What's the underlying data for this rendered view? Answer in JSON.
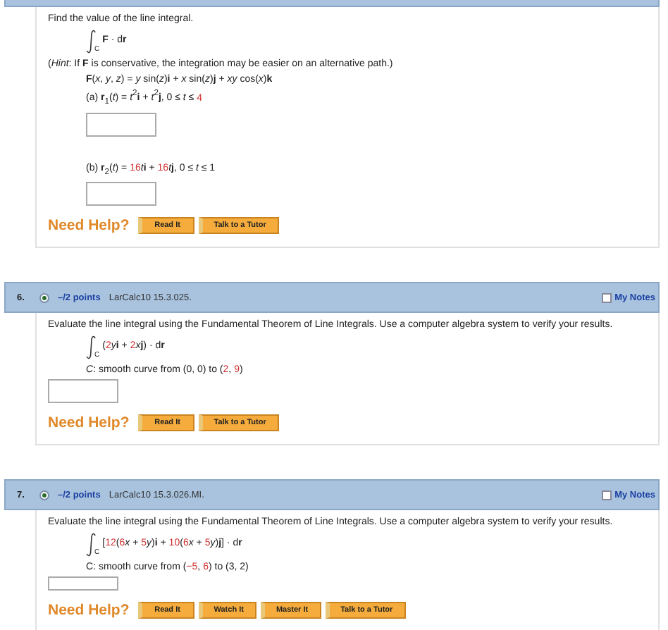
{
  "questions": [
    {
      "kind": "partial",
      "body": [
        {
          "kind": "text",
          "text": "Find the value of the line integral."
        },
        {
          "kind": "integral",
          "sub": "C",
          "expr": [
            {
              "t": "**F** · d**r**",
              "red": false
            }
          ]
        },
        {
          "kind": "text",
          "text": "(*Hint*: If **F** is conservative, the integration may be easier on an alternative path.)"
        },
        {
          "kind": "math",
          "segs": [
            {
              "t": "**F**(*x*, *y*, *z*) = *y* sin(*z*)**i** + *x* sin(*z*)**j** + *xy* cos(*x*)**k**",
              "red": false
            }
          ]
        },
        {
          "kind": "math",
          "segs": [
            {
              "t": "(a)    **r**$_{1}$(*t*) = *t*$^{2}$**i** + *t*$^{2}$**j**,    0 ≤ *t* ≤ ",
              "red": false
            },
            {
              "t": "4",
              "red": true
            }
          ]
        },
        {
          "kind": "answer_indent"
        },
        {
          "kind": "gap"
        },
        {
          "kind": "math",
          "segs": [
            {
              "t": "(b)    **r**$_{2}$(*t*) = ",
              "red": false
            },
            {
              "t": "16",
              "red": true
            },
            {
              "t": "*t*",
              "red": false
            },
            {
              "t": "**i** + ",
              "red": false
            },
            {
              "t": "16",
              "red": true
            },
            {
              "t": "*t*",
              "red": false
            },
            {
              "t": "**j**,    0 ≤ *t* ≤ 1",
              "red": false
            }
          ]
        },
        {
          "kind": "answer_indent"
        },
        {
          "kind": "help",
          "label": "Need Help?",
          "buttons": [
            "Read It",
            "Talk to a Tutor"
          ]
        }
      ]
    },
    {
      "kind": "full",
      "number": "6.",
      "points": "–/2 points",
      "code": "LarCalc10 15.3.025.",
      "notes": "My Notes",
      "notes_checked": false,
      "body": [
        {
          "kind": "text",
          "text": "Evaluate the line integral using the Fundamental Theorem of Line Integrals. Use a computer algebra system to verify your results."
        },
        {
          "kind": "integral",
          "sub": "C",
          "expr": [
            {
              "t": "(",
              "red": false
            },
            {
              "t": "2",
              "red": true
            },
            {
              "t": "*y*",
              "red": false
            },
            {
              "t": "**i** + ",
              "red": false
            },
            {
              "t": "2",
              "red": true
            },
            {
              "t": "*x*",
              "red": false
            },
            {
              "t": "**j**) · d**r**",
              "red": false
            }
          ]
        },
        {
          "kind": "math",
          "segs": [
            {
              "t": "*C*: smooth curve from (0, 0) to (",
              "red": false
            },
            {
              "t": "2",
              "red": true
            },
            {
              "t": ", ",
              "red": false
            },
            {
              "t": "9",
              "red": true
            },
            {
              "t": ")",
              "red": false
            }
          ]
        },
        {
          "kind": "answer"
        },
        {
          "kind": "help",
          "label": "Need Help?",
          "buttons": [
            "Read It",
            "Talk to a Tutor"
          ]
        }
      ]
    },
    {
      "kind": "full",
      "number": "7.",
      "points": "–/2 points",
      "code": "LarCalc10 15.3.026.MI.",
      "notes": "My Notes",
      "notes_checked": false,
      "body": [
        {
          "kind": "text",
          "text": "Evaluate the line integral using the Fundamental Theorem of Line Integrals. Use a computer algebra system to verify your results."
        },
        {
          "kind": "integral",
          "sub": "C",
          "expr": [
            {
              "t": "[",
              "red": false
            },
            {
              "t": "12",
              "red": true
            },
            {
              "t": "(",
              "red": false
            },
            {
              "t": "6",
              "red": true
            },
            {
              "t": "*x* + ",
              "red": false
            },
            {
              "t": "5",
              "red": true
            },
            {
              "t": "*y*)**i** + ",
              "red": false
            },
            {
              "t": "10",
              "red": true
            },
            {
              "t": "(",
              "red": false
            },
            {
              "t": "6",
              "red": true
            },
            {
              "t": "*x* + ",
              "red": false
            },
            {
              "t": "5",
              "red": true
            },
            {
              "t": "*y*)**j**] · d**r**",
              "red": false
            }
          ]
        },
        {
          "kind": "math",
          "segs": [
            {
              "t": "C: smooth curve from (",
              "red": false
            },
            {
              "t": "−5",
              "red": true
            },
            {
              "t": ", ",
              "red": false
            },
            {
              "t": "6",
              "red": true
            },
            {
              "t": ") to (3, 2)",
              "red": false
            }
          ]
        },
        {
          "kind": "answer_short"
        },
        {
          "kind": "help",
          "label": "Need Help?",
          "buttons": [
            "Read It",
            "Watch It",
            "Master It",
            "Talk to a Tutor"
          ]
        }
      ]
    }
  ]
}
